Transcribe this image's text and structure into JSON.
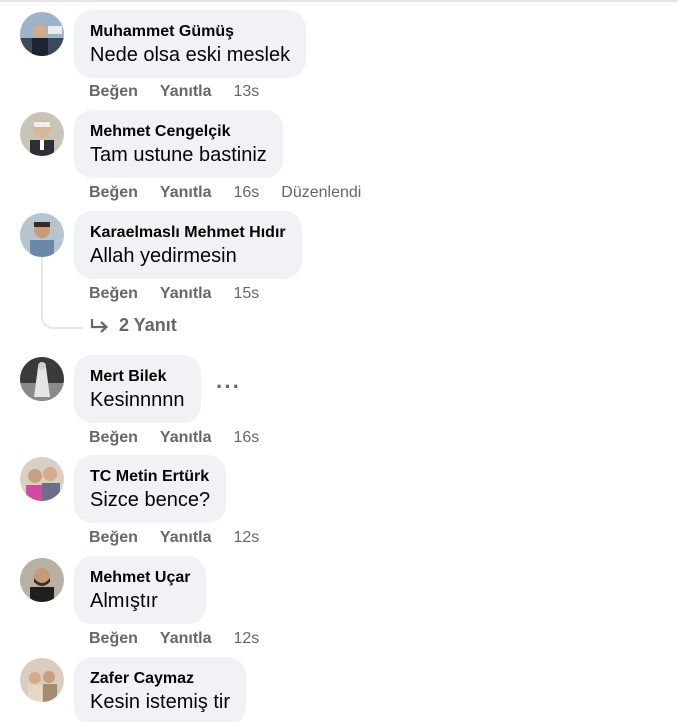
{
  "comments": [
    {
      "author": "Muhammet Gümüş",
      "text": "Nede olsa eski meslek",
      "like": "Beğen",
      "reply": "Yanıtla",
      "time": "13s",
      "edited": ""
    },
    {
      "author": "Mehmet Cengelçik",
      "text": "Tam ustune bastiniz",
      "like": "Beğen",
      "reply": "Yanıtla",
      "time": "16s",
      "edited": "Düzenlendi"
    },
    {
      "author": "Karaelmaslı Mehmet Hıdır",
      "text": "Allah yedirmesin",
      "like": "Beğen",
      "reply": "Yanıtla",
      "time": "15s",
      "edited": ""
    },
    {
      "author": "Mert Bilek",
      "text": "Kesinnnnn",
      "like": "Beğen",
      "reply": "Yanıtla",
      "time": "16s",
      "edited": ""
    },
    {
      "author": "TC Metin Ertürk",
      "text": "Sizce bence?",
      "like": "Beğen",
      "reply": "Yanıtla",
      "time": "12s",
      "edited": ""
    },
    {
      "author": "Mehmet Uçar",
      "text": "Almıştır",
      "like": "Beğen",
      "reply": "Yanıtla",
      "time": "12s",
      "edited": ""
    },
    {
      "author": "Zafer Caymaz",
      "text": "Kesin istemiş tir",
      "like": "",
      "reply": "",
      "time": "",
      "edited": ""
    }
  ],
  "replies_link": "2 Yanıt",
  "more_options": "···",
  "colors": {
    "bubble": "#f0f2f5",
    "meta": "#65676b",
    "text": "#050505"
  }
}
